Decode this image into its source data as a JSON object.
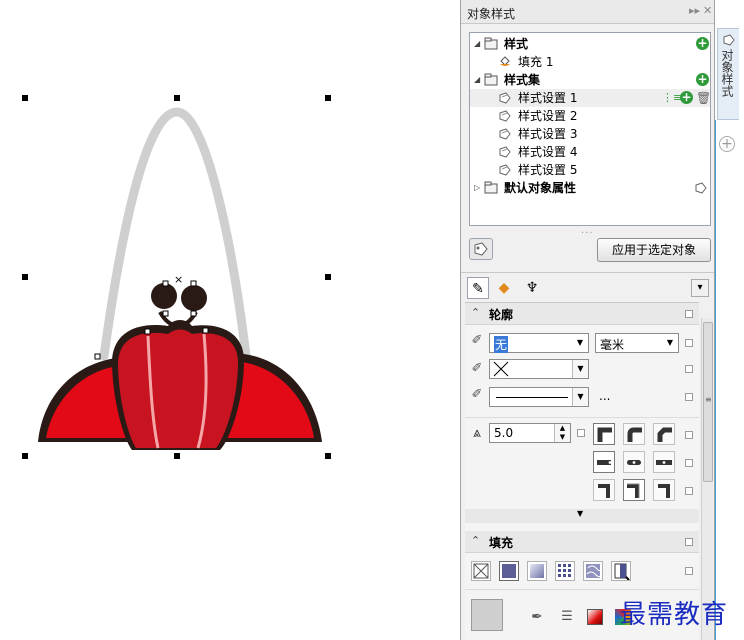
{
  "panel": {
    "title": "对象样式",
    "tree": [
      {
        "label": "样式",
        "bold": true,
        "level": 0,
        "twisty": "◢",
        "add": true
      },
      {
        "label": "填充 1",
        "bold": false,
        "level": 1
      },
      {
        "label": "样式集",
        "bold": true,
        "level": 0,
        "twisty": "◢",
        "add": true
      },
      {
        "label": "样式设置 1",
        "bold": false,
        "level": 1,
        "selected": true
      },
      {
        "label": "样式设置 2",
        "bold": false,
        "level": 1
      },
      {
        "label": "样式设置 3",
        "bold": false,
        "level": 1
      },
      {
        "label": "样式设置 4",
        "bold": false,
        "level": 1
      },
      {
        "label": "样式设置 5",
        "bold": false,
        "level": 1
      },
      {
        "label": "默认对象属性",
        "bold": true,
        "level": 0,
        "twisty": "▷"
      }
    ],
    "apply_button": "应用于选定对象",
    "outline": {
      "title": "轮廓",
      "color_value": "无",
      "unit_value": "毫米",
      "more_label": "...",
      "miter_value": "5.0"
    },
    "fill": {
      "title": "填充"
    }
  },
  "side_tab": {
    "label": "对象样式"
  },
  "watermark": "最需教育",
  "colors": {
    "bag_red": "#e20a16",
    "bag_dark_red": "#c81320",
    "outline_dark": "#2a1a16",
    "handle_gray": "#cfcfcf",
    "accent_blue": "#3aa0e0"
  }
}
